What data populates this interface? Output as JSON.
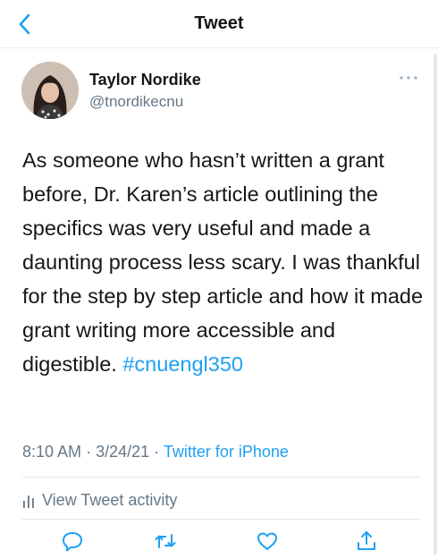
{
  "header": {
    "title": "Tweet",
    "back_icon": "chevron-left-icon"
  },
  "author": {
    "name": "Taylor Nordike",
    "handle": "@tnordikecnu"
  },
  "tweet": {
    "text": "As someone who hasn’t written a grant before, Dr. Karen’s article outlining the specifics was very useful and made a daunting process less scary. I was thankful for the step by step article and how it made grant writing more accessible and digestible.",
    "hashtag": "#cnuengl350"
  },
  "meta": {
    "time": "8:10 AM",
    "separator": "·",
    "date": "3/24/21",
    "source": "Twitter for iPhone"
  },
  "activity": {
    "label": "View Tweet activity",
    "icon": "bar-chart-icon"
  },
  "actions": [
    {
      "icon": "reply-icon"
    },
    {
      "icon": "retweet-icon"
    },
    {
      "icon": "like-icon"
    },
    {
      "icon": "share-icon"
    }
  ],
  "colors": {
    "accent": "#1da1f2",
    "text": "#14171a",
    "secondary": "#657786",
    "divider": "#e1e8ed"
  }
}
